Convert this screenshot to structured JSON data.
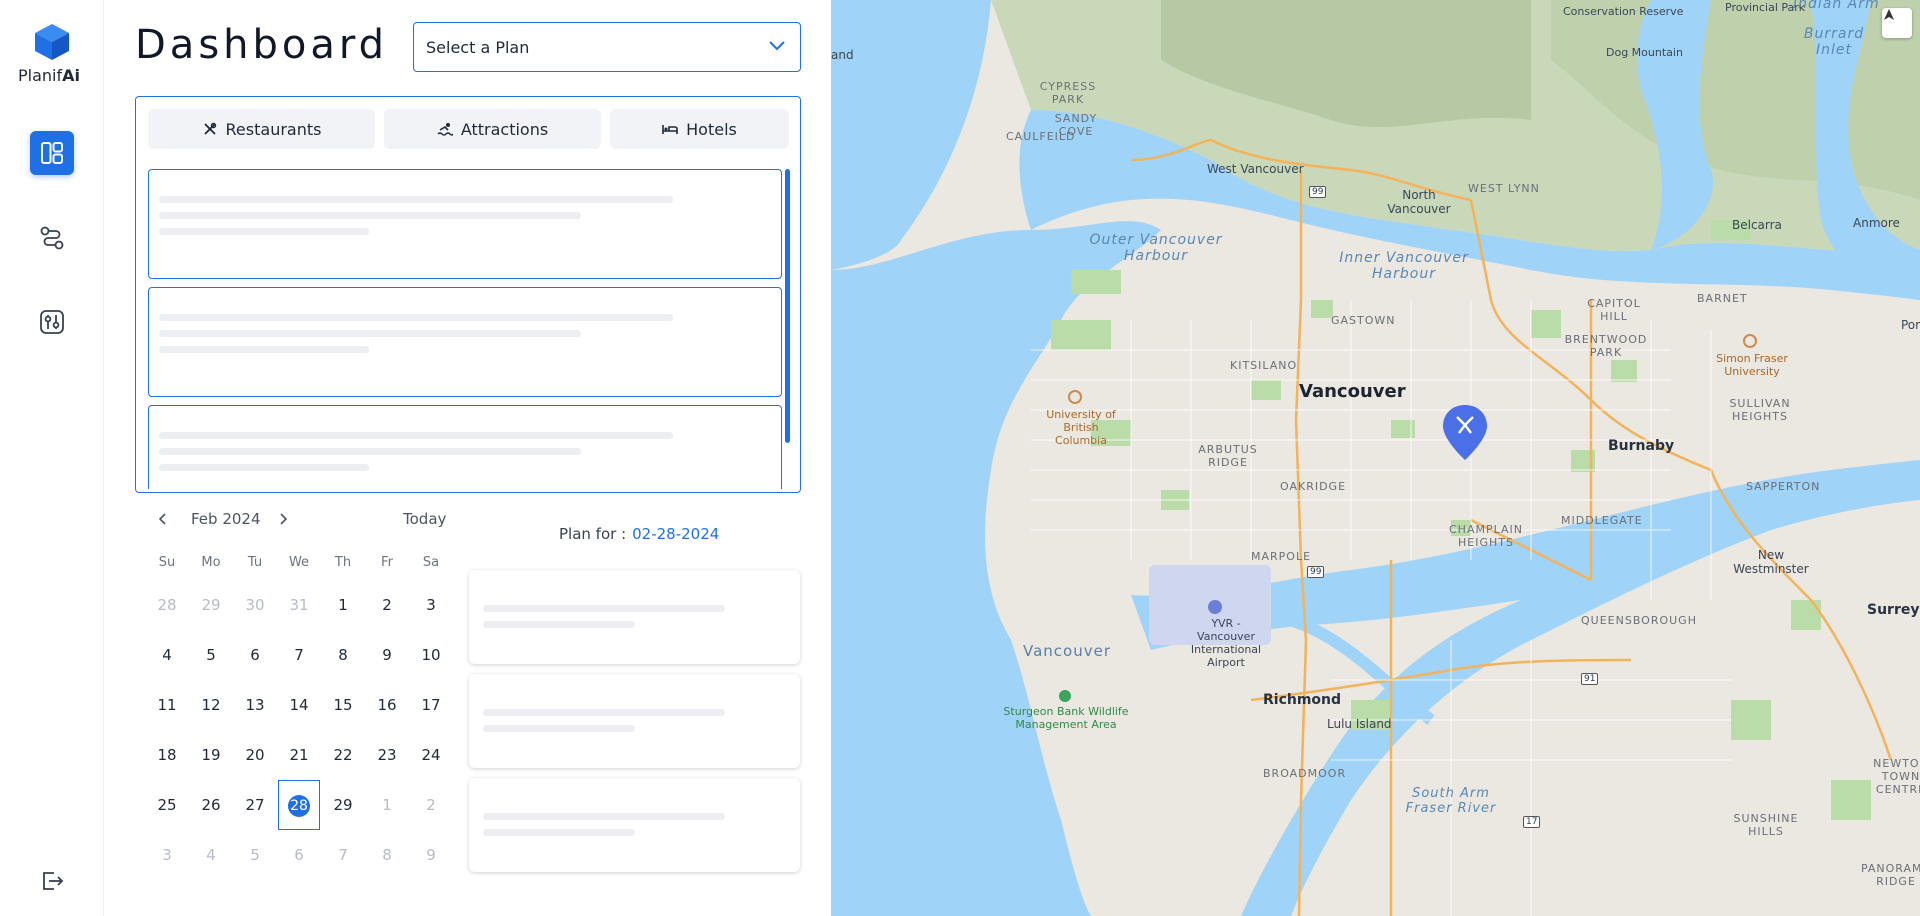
{
  "app": {
    "logo_name_prefix": "Planif",
    "logo_name_suffix": "Ai",
    "brand_color": "#1f6fe5"
  },
  "sidebar": {
    "items": [
      {
        "name": "dashboard",
        "icon": "dashboard-icon",
        "active": true
      },
      {
        "name": "routes",
        "icon": "route-icon",
        "active": false
      },
      {
        "name": "settings",
        "icon": "sliders-icon",
        "active": false
      }
    ],
    "logout_icon": "logout-icon"
  },
  "header": {
    "title": "Dashboard",
    "plan_select": {
      "value": "Select a Plan"
    }
  },
  "places": {
    "tabs": [
      {
        "label": "Restaurants",
        "icon": "utensils-icon"
      },
      {
        "label": "Attractions",
        "icon": "swimmer-icon"
      },
      {
        "label": "Hotels",
        "icon": "bed-icon"
      }
    ]
  },
  "calendar": {
    "month_label": "Feb 2024",
    "today_label": "Today",
    "weekdays": [
      "Su",
      "Mo",
      "Tu",
      "We",
      "Th",
      "Fr",
      "Sa"
    ],
    "weeks": [
      [
        "28",
        "29",
        "30",
        "31",
        "1",
        "2",
        "3"
      ],
      [
        "4",
        "5",
        "6",
        "7",
        "8",
        "9",
        "10"
      ],
      [
        "11",
        "12",
        "13",
        "14",
        "15",
        "16",
        "17"
      ],
      [
        "18",
        "19",
        "20",
        "21",
        "22",
        "23",
        "24"
      ],
      [
        "25",
        "26",
        "27",
        "28",
        "29",
        "1",
        "2"
      ],
      [
        "3",
        "4",
        "5",
        "6",
        "7",
        "8",
        "9"
      ]
    ],
    "selected_day": "28"
  },
  "plan": {
    "label": "Plan for :",
    "date": "02-28-2024"
  },
  "map": {
    "labels": {
      "west_vancouver": "West Vancouver",
      "north_vancouver": "North Vancouver",
      "west_lynn": "WEST LYNN",
      "belcarra": "Belcarra",
      "anmore": "Anmore",
      "outer_harbour": "Outer Vancouver Harbour",
      "inner_harbour": "Inner Vancouver Harbour",
      "cypress_park": "CYPRESS PARK",
      "sandy_cove": "SANDY COVE",
      "caulfeild": "CAULFEILD",
      "capitol_hill": "CAPITOL HILL",
      "barnet": "BARNET",
      "brentwood_park": "BRENTWOOD PARK",
      "gastown": "GASTOWN",
      "kitsilano": "KITSILANO",
      "vancouver": "Vancouver",
      "ubc": "University of British Columbia",
      "sfu": "Simon Fraser University",
      "sullivan_heights": "SULLIVAN HEIGHTS",
      "burnaby": "Burnaby",
      "arbutus_ridge": "ARBUTUS RIDGE",
      "oakridge": "OAKRIDGE",
      "champlain_heights": "CHAMPLAIN HEIGHTS",
      "middlegate": "MIDDLEGATE",
      "sapperton": "SAPPERTON",
      "new_westminster": "New Westminster",
      "marpole": "MARPOLE",
      "yvr": "YVR - Vancouver International Airport",
      "queensborough": "QUEENSBOROUGH",
      "surrey": "Surrey",
      "vancouver_water": "Vancouver",
      "sturgeon_bank": "Sturgeon Bank Wildlife Management Area",
      "richmond": "Richmond",
      "lulu_island": "Lulu Island",
      "broadmoor": "BROADMOOR",
      "south_arm": "South Arm Fraser River",
      "sunshine_hills": "SUNSHINE HILLS",
      "newton_town_centre": "NEWTON TOWN CENTRE",
      "panorama_ridge": "PANORAMA RIDGE",
      "dog_mountain": "Dog Mountain",
      "conservation_reserve": "Conservation Reserve",
      "provincial_park": "Provincial Park",
      "indian_arm": "Indian Arm",
      "burrard_inlet": "Burrard Inlet",
      "land": "and",
      "port": "Por",
      "hwy99": "99",
      "hwy91": "91",
      "hwy17": "17"
    }
  }
}
